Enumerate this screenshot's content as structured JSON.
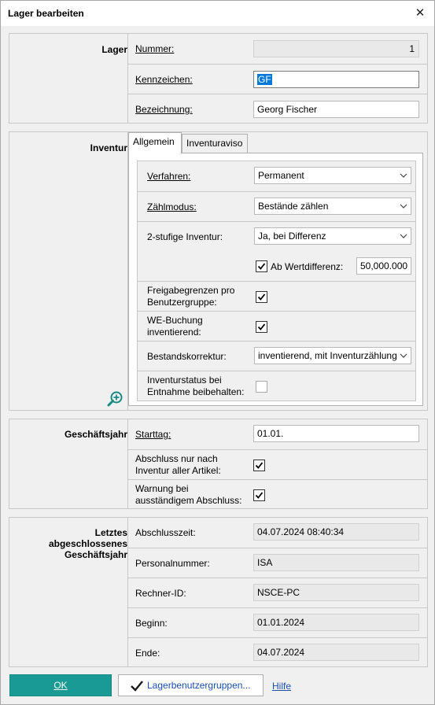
{
  "window": {
    "title": "Lager bearbeiten"
  },
  "lager": {
    "section_label": "Lager",
    "nummer_label": "Nummer:",
    "nummer_value": "1",
    "kennzeichen_label": "Kennzeichen:",
    "kennzeichen_value": "GF",
    "bezeichnung_label": "Bezeichnung:",
    "bezeichnung_value": "Georg Fischer"
  },
  "inventur": {
    "section_label": "Inventur",
    "tabs": [
      {
        "label": "Allgemein"
      },
      {
        "label": "Inventuraviso"
      }
    ],
    "verfahren_label": "Verfahren:",
    "verfahren_value": "Permanent",
    "zaehlmodus_label": "Zählmodus:",
    "zaehlmodus_value": "Bestände zählen",
    "zweistufig_label": "2-stufige Inventur:",
    "zweistufig_value": "Ja, bei Differenz",
    "ab_wertdifferenz_label": "Ab Wertdifferenz:",
    "ab_wertdifferenz_checked": true,
    "ab_wertdifferenz_value": "50,000.000",
    "freigabegrenzen_label_1": "Freigabegrenzen pro",
    "freigabegrenzen_label_2": "Benutzergruppe:",
    "freigabegrenzen_checked": true,
    "we_buchung_label_1": "WE-Buchung",
    "we_buchung_label_2": "inventierend:",
    "we_buchung_checked": true,
    "bestandskorrektur_label": "Bestandskorrektur:",
    "bestandskorrektur_value": "inventierend, mit Inventurzählung",
    "inventurstatus_label_1": "Inventurstatus bei",
    "inventurstatus_label_2": "Entnahme beibehalten:",
    "inventurstatus_checked": false
  },
  "geschaeftsjahr": {
    "section_label": "Geschäftsjahr",
    "starttag_label": "Starttag:",
    "starttag_value": "01.01.",
    "abschluss_label_1": "Abschluss nur nach",
    "abschluss_label_2": "Inventur aller Artikel:",
    "abschluss_checked": true,
    "warnung_label_1": "Warnung bei",
    "warnung_label_2": "ausständigem Abschluss:",
    "warnung_checked": true
  },
  "letztes": {
    "section_label_1": "Letztes",
    "section_label_2": "abgeschlossenes",
    "section_label_3": "Geschäftsjahr",
    "abschlusszeit_label": "Abschlusszeit:",
    "abschlusszeit_value": "04.07.2024 08:40:34",
    "personalnummer_label": "Personalnummer:",
    "personalnummer_value": "ISA",
    "rechner_label": "Rechner-ID:",
    "rechner_value": "NSCE-PC",
    "beginn_label": "Beginn:",
    "beginn_value": "01.01.2024",
    "ende_label": "Ende:",
    "ende_value": "04.07.2024"
  },
  "footer": {
    "ok_label": "OK",
    "lagerbenutzergruppen_label": "Lagerbenutzergruppen...",
    "hilfe_label": "Hilfe"
  },
  "colors": {
    "accent": "#1a9a94",
    "link": "#1a4fb0",
    "selection": "#0078d7"
  },
  "icons": {
    "close": "close-icon",
    "zoom": "zoom-in-icon",
    "check": "checkmark-icon",
    "dropdown": "chevron-down-icon"
  }
}
